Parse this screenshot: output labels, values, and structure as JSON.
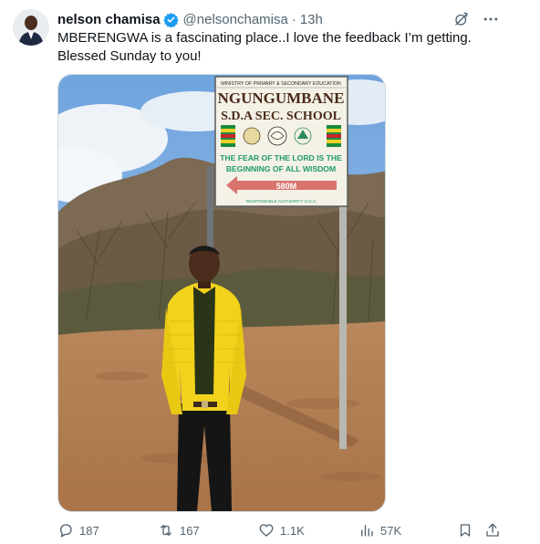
{
  "tweet": {
    "author_name": "nelson chamisa",
    "handle": "@nelsonchamisa",
    "separator": "·",
    "time": "13h",
    "text": "MBERENGWA is a fascinating place..I love the feedback I’m getting. Blessed Sunday to you!"
  },
  "sign": {
    "top_line": "MINISTRY OF PRIMARY & SECONDARY EDUCATION",
    "school_line1": "NGUNGUMBANE",
    "school_line2": "S.D.A SEC. SCHOOL",
    "motto_line1": "THE FEAR OF THE LORD IS THE",
    "motto_line2": "BEGINNING OF ALL WISDOM",
    "distance": "580M",
    "footer": "RESPONSIBLE AUTHORITY S.D.A"
  },
  "actions": {
    "replies": "187",
    "reposts": "167",
    "likes": "1.1K",
    "views": "57K"
  },
  "icons": {
    "verified": "verified-badge-icon",
    "grok": "grok-icon",
    "more": "more-icon",
    "reply": "reply-icon",
    "repost": "repost-icon",
    "like": "heart-icon",
    "views": "views-icon",
    "bookmark": "bookmark-icon",
    "share": "share-icon"
  },
  "colors": {
    "verified_blue": "#1d9bf0",
    "muted_text": "#536471",
    "jacket_yellow": "#f2d21b"
  }
}
